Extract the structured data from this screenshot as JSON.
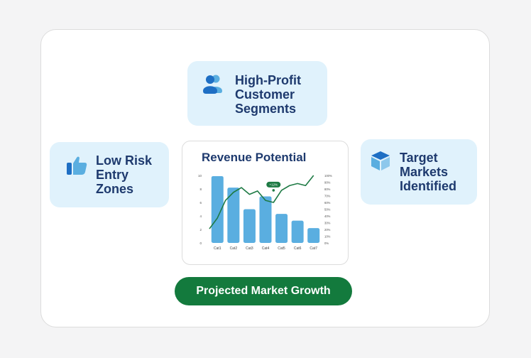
{
  "tiles": {
    "top": {
      "label": "High-Profit Customer Segments",
      "icon": "users-icon"
    },
    "left": {
      "label": "Low Risk Entry Zones",
      "icon": "thumbs-up-icon"
    },
    "right": {
      "label": "Target Markets Identified",
      "icon": "cube-icon"
    }
  },
  "cta": {
    "label": "Projected Market Growth"
  },
  "colors": {
    "bar": "#5aaee0",
    "line": "#1e7a44",
    "tile_bg": "#e0f2fc",
    "heading": "#1e3a6e",
    "cta_bg": "#137a3d"
  },
  "chart_data": {
    "type": "bar",
    "title": "Revenue Potential",
    "categories": [
      "Cat1",
      "Cat2",
      "Cat3",
      "Cat4",
      "Cat5",
      "Cat6",
      "Cat7"
    ],
    "values": [
      9.9,
      8.2,
      5.0,
      6.9,
      4.3,
      3.3,
      2.2
    ],
    "ylim": [
      0,
      10
    ],
    "yticks": [
      "0",
      "2",
      "4",
      "6",
      "8",
      "10"
    ],
    "line": {
      "x": [
        0,
        0.5,
        1,
        1.5,
        2,
        2.5,
        3,
        3.5,
        4,
        4.5,
        5,
        5.5,
        6,
        6.5
      ],
      "y": [
        21,
        37,
        63,
        75,
        82,
        72,
        77,
        63,
        60,
        78,
        85,
        88,
        85,
        100
      ]
    },
    "y2lim": [
      0,
      100
    ],
    "y2ticks": [
      "0%",
      "10%",
      "20%",
      "30%",
      "40%",
      "50%",
      "60%",
      "70%",
      "80%",
      "90%",
      "100%"
    ],
    "annotation": {
      "text": "+12%",
      "x": 4.0,
      "y": 78
    },
    "grid": false
  }
}
